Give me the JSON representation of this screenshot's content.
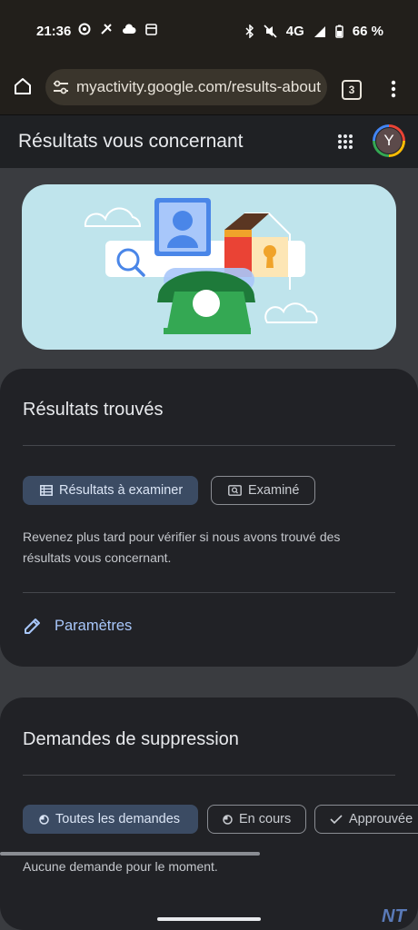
{
  "status_bar": {
    "time": "21:36",
    "network": "4G",
    "battery": "66 %",
    "left_icons": [
      "sync-icon",
      "tools-icon",
      "cloud-icon",
      "calendar-icon"
    ],
    "right_icons": [
      "bluetooth-icon",
      "mute-icon",
      "signal-icon",
      "battery-icon"
    ]
  },
  "browser": {
    "url": "myactivity.google.com/results-about",
    "tab_count": "3"
  },
  "header": {
    "title": "Résultats vous concernant",
    "avatar_letter": "Y"
  },
  "results_card": {
    "title": "Résultats trouvés",
    "chip_to_review": "Résultats à examiner",
    "chip_reviewed": "Examiné",
    "message": "Revenez plus tard pour vérifier si nous avons trouvé des résultats vous concernant.",
    "settings_label": "Paramètres"
  },
  "removal_card": {
    "title": "Demandes de suppression",
    "chip_all": "Toutes les demandes",
    "chip_in_progress": "En cours",
    "chip_approved": "Approuvée",
    "message": "Aucune demande pour le moment."
  },
  "watermark": "NT",
  "colors": {
    "accent": "#a8c7fa",
    "selected_chip": "#3b4b63",
    "card_bg": "#212226",
    "page_bg": "#3a3c40",
    "hero_bg": "#bfe4ec"
  }
}
